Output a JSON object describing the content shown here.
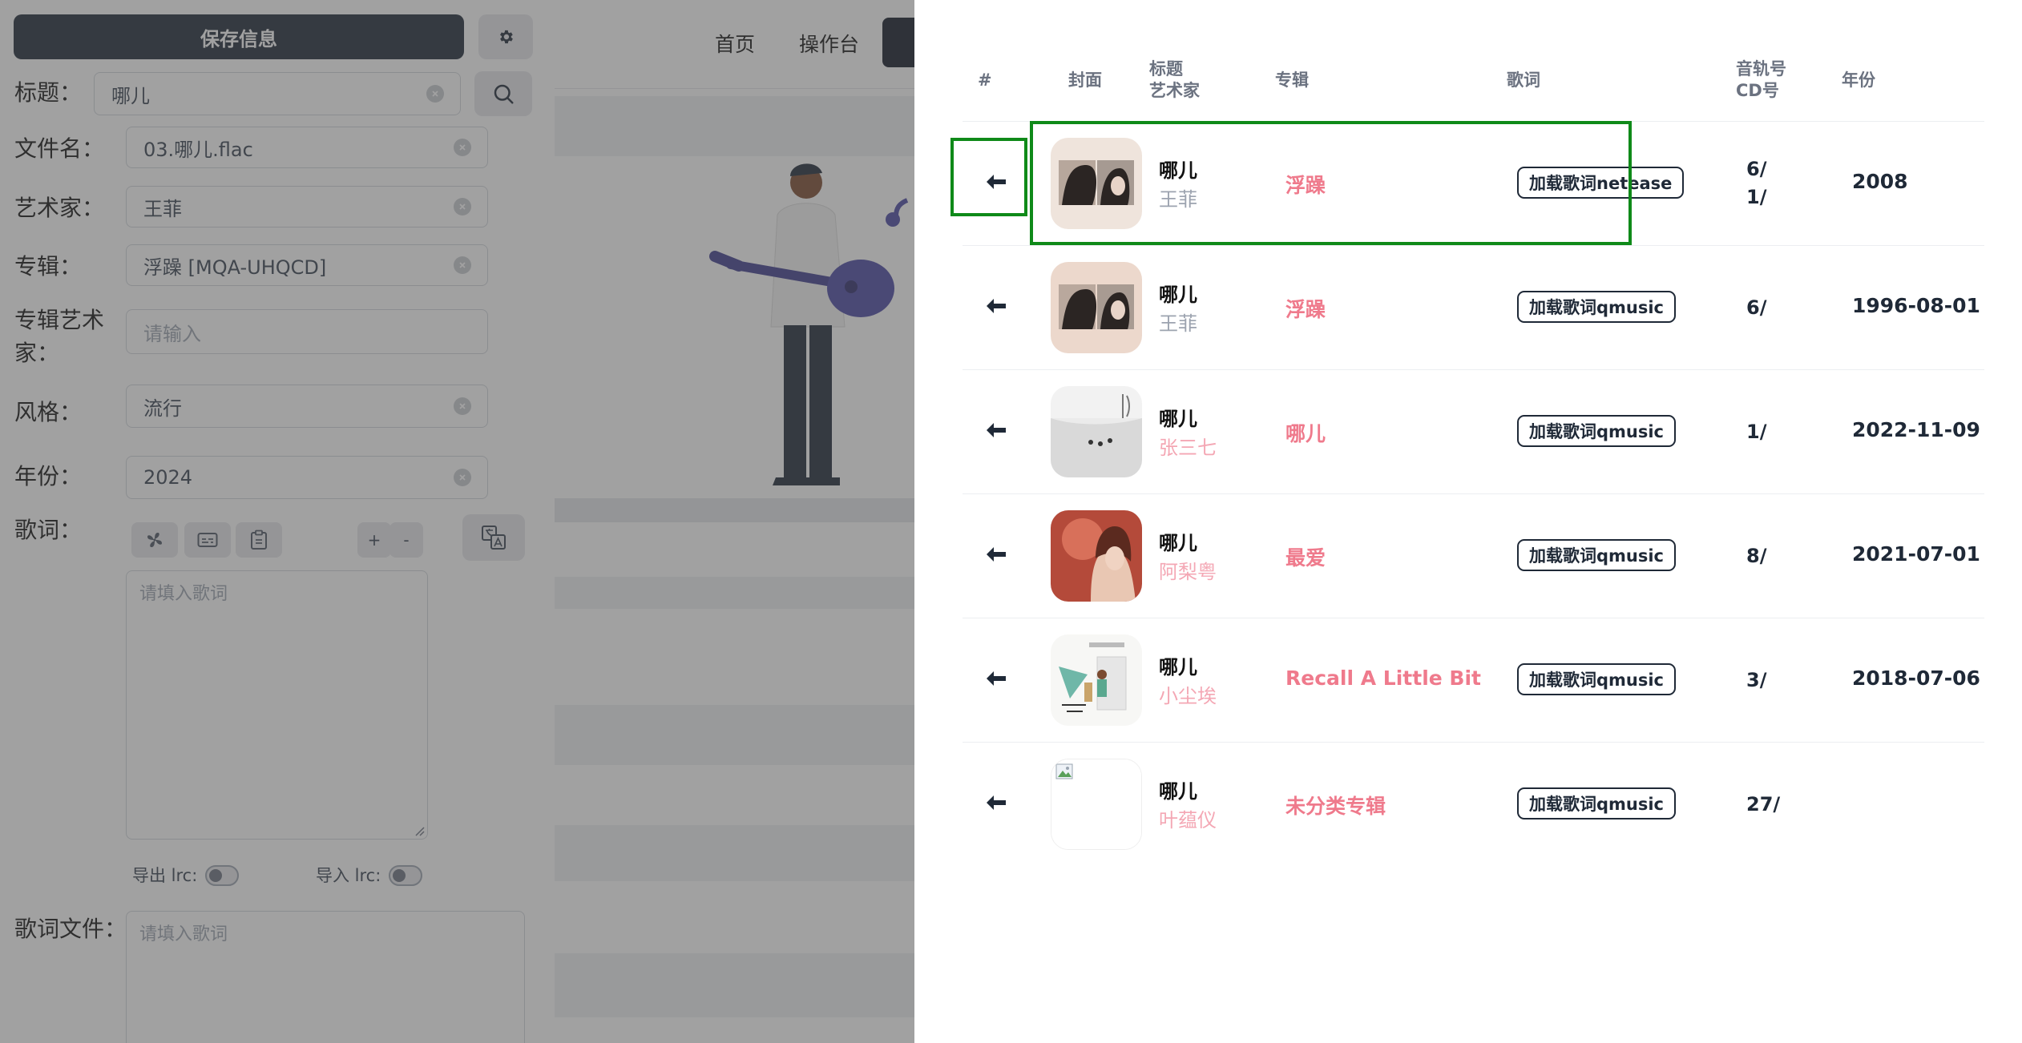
{
  "editor": {
    "save_label": "保存信息",
    "fields": {
      "title": {
        "label": "标题：",
        "value": "哪儿"
      },
      "filename": {
        "label": "文件名：",
        "value": "03.哪儿.flac"
      },
      "artist": {
        "label": "艺术家：",
        "value": "王菲"
      },
      "album": {
        "label": "专辑：",
        "value": "浮躁 [MQA-UHQCD]"
      },
      "album_artist": {
        "label_line1": "专辑艺术",
        "label_line2": "家：",
        "placeholder": "请输入"
      },
      "genre": {
        "label": "风格：",
        "value": "流行"
      },
      "year": {
        "label": "年份：",
        "value": "2024"
      }
    },
    "lyrics": {
      "label": "歌词：",
      "plus": "+",
      "minus": "-",
      "placeholder": "请填入歌词",
      "export_label": "导出 lrc:",
      "import_label": "导入 lrc:"
    },
    "lyric_file": {
      "label": "歌词文件：",
      "placeholder": "请填入歌词"
    }
  },
  "background_nav": {
    "home": "首页",
    "console": "操作台"
  },
  "results_table": {
    "headers": {
      "index": "#",
      "cover": "封面",
      "title": "标题",
      "artist": "艺术家",
      "album": "专辑",
      "lyrics": "歌词",
      "track": "音轨号",
      "cd": "CD号",
      "year": "年份"
    },
    "rows": [
      {
        "title": "哪儿",
        "artist": "王菲",
        "album": "浮躁",
        "lyric_button": "加载歌词netease",
        "track": "6/",
        "cd": "1/",
        "year": "2008"
      },
      {
        "title": "哪儿",
        "artist": "王菲",
        "album": "浮躁",
        "lyric_button": "加载歌词qmusic",
        "track": "6/",
        "cd": "",
        "year": "1996-08-01"
      },
      {
        "title": "哪儿",
        "artist": "张三七",
        "album": "哪儿",
        "lyric_button": "加载歌词qmusic",
        "track": "1/",
        "cd": "",
        "year": "2022-11-09"
      },
      {
        "title": "哪儿",
        "artist": "阿梨粤",
        "album": "最爱",
        "lyric_button": "加载歌词qmusic",
        "track": "8/",
        "cd": "",
        "year": "2021-07-01"
      },
      {
        "title": "哪儿",
        "artist": "小尘埃",
        "album": "Recall A Little Bit",
        "lyric_button": "加载歌词qmusic",
        "track": "3/",
        "cd": "",
        "year": "2018-07-06"
      },
      {
        "title": "哪儿",
        "artist": "叶蕴仪",
        "album": "未分类专辑",
        "lyric_button": "加载歌词qmusic",
        "track": "27/",
        "cd": "",
        "year": ""
      }
    ]
  },
  "colors": {
    "accent_dark": "#1f2937",
    "album_pink": "#ef7a8c",
    "highlight_green": "#0f8a19"
  }
}
